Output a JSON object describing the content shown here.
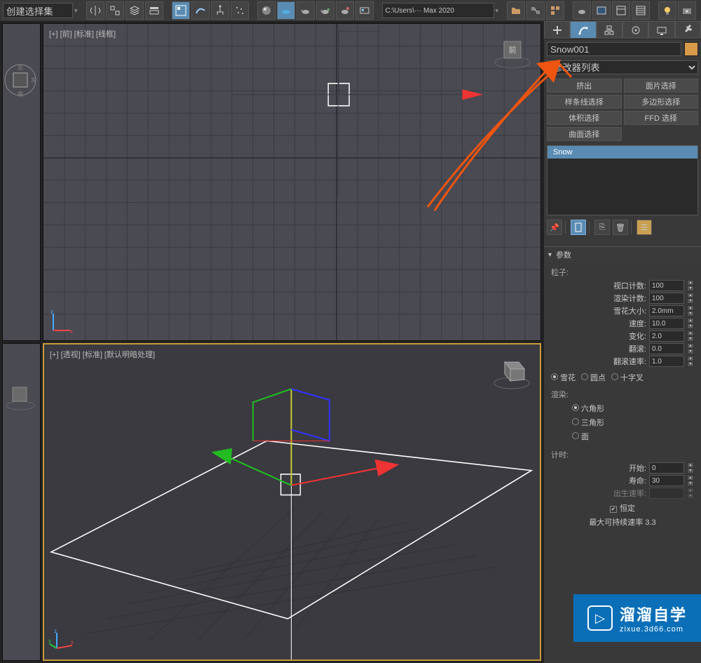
{
  "toolbar": {
    "selection_set": "创建选择集",
    "path": "C:\\Users\\··· Max 2020"
  },
  "viewports": {
    "front_label": "[+] [前] [标准] [线框]",
    "front_cube": "前",
    "persp_label": "[+] [透视] [标准] [默认明暗处理]"
  },
  "panel": {
    "object_name": "Snow001",
    "modifier_list": "修改器列表",
    "buttons": {
      "extrude": "挤出",
      "face_select": "面片选择",
      "spline_select": "样条线选择",
      "poly_select": "多边形选择",
      "volume_select": "体积选择",
      "ffd_select": "FFD 选择",
      "surface_select": "曲面选择"
    },
    "stack_item": "Snow",
    "rollup_title": "参数",
    "particles_group": "粒子:",
    "params": {
      "viewport_count": {
        "label": "视口计数:",
        "value": "100"
      },
      "render_count": {
        "label": "渲染计数:",
        "value": "100"
      },
      "flake_size": {
        "label": "雪花大小:",
        "value": "2.0mm"
      },
      "speed": {
        "label": "速度:",
        "value": "10.0"
      },
      "variation": {
        "label": "变化:",
        "value": "2.0"
      },
      "tumble": {
        "label": "翻滚:",
        "value": "0.0"
      },
      "tumble_rate": {
        "label": "翻滚速率:",
        "value": "1.0"
      }
    },
    "particle_type": {
      "snow": "雪花",
      "dot": "圆点",
      "cross": "十字叉"
    },
    "render_group": "渲染:",
    "render_type": {
      "hex": "六角形",
      "tri": "三角形",
      "face": "面"
    },
    "timing_group": "计时:",
    "timing": {
      "start": {
        "label": "开始:",
        "value": "0"
      },
      "life": {
        "label": "寿命:",
        "value": "30"
      },
      "birth_rate": {
        "label": "出生速率:",
        "value": ""
      }
    },
    "constant": "恒定",
    "max_sustain": "最大可持续速率 3.3"
  },
  "watermark": {
    "title": "溜溜自学",
    "url": "zixue.3d66.com"
  }
}
